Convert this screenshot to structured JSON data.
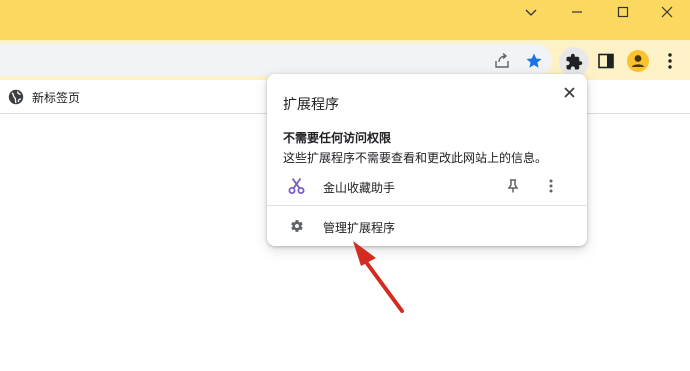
{
  "window": {
    "controls": [
      "chevron-down-icon",
      "minimize-icon",
      "maximize-icon",
      "close-icon"
    ],
    "titlebar_color": "#fbd85f"
  },
  "toolbar": {
    "icons": [
      "share-icon",
      "bookmark-star-icon",
      "extensions-puzzle-icon",
      "side-panel-icon",
      "profile-avatar-icon",
      "more-vert-icon"
    ],
    "star_color": "#1a73e8",
    "avatar_color": "#f9c22e"
  },
  "bookmarks": {
    "items": [
      {
        "label": "新标签页",
        "icon": "globe-icon"
      }
    ]
  },
  "extensions_popup": {
    "title": "扩展程序",
    "section_heading": "不需要任何访问权限",
    "section_desc": "这些扩展程序不需要查看和更改此网站上的信息。",
    "extensions": [
      {
        "name": "金山收藏助手",
        "icon": "scissors-icon",
        "icon_color": "#7a5cc8"
      }
    ],
    "manage_label": "管理扩展程序",
    "manage_icon": "gear-icon"
  },
  "annotation": {
    "arrow_color": "#d42a20"
  }
}
